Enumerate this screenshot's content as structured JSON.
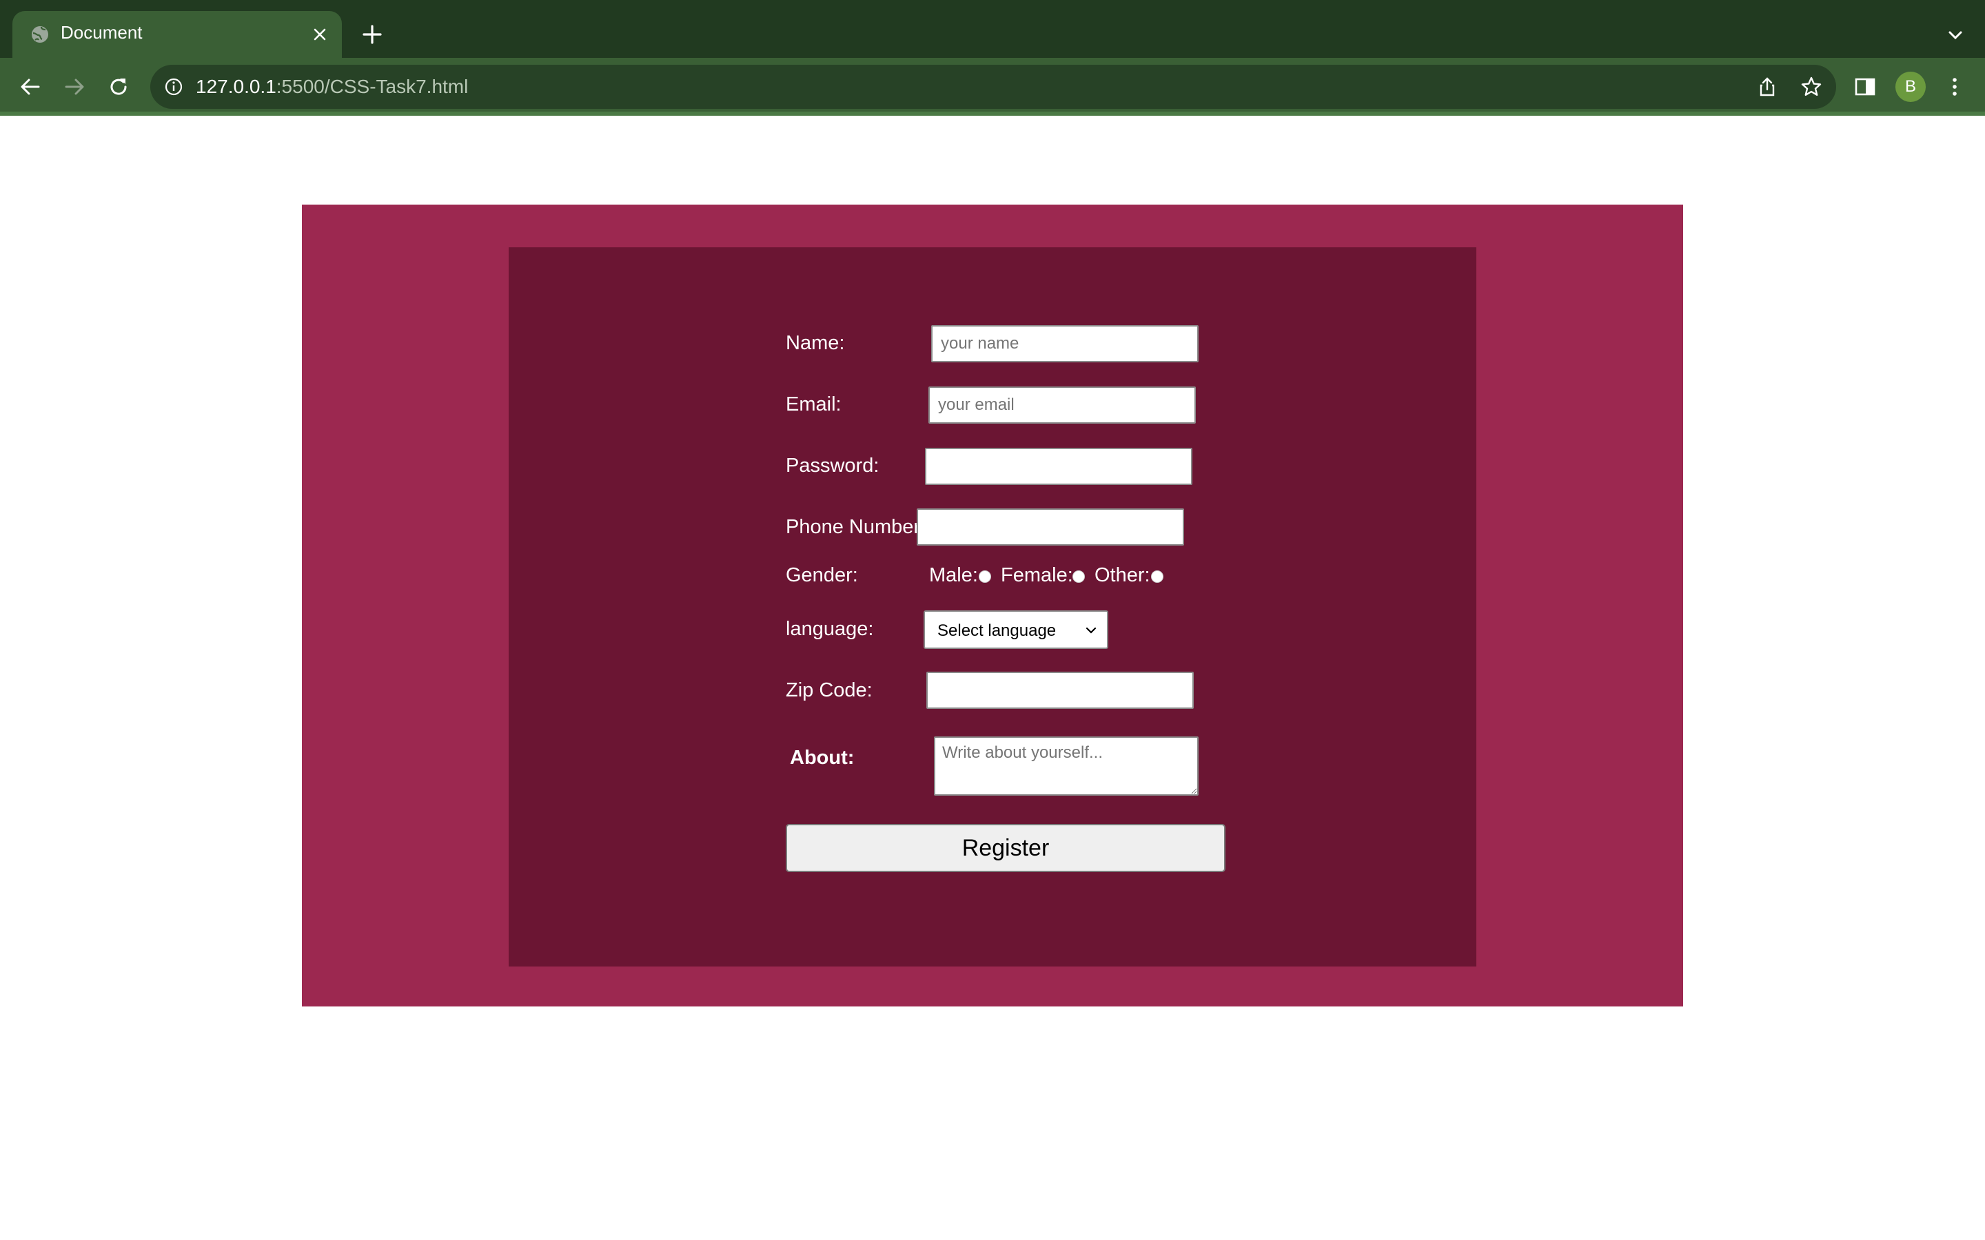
{
  "browser": {
    "tab_title": "Document",
    "url_host": "127.0.0.1",
    "url_rest": ":5500/CSS-Task7.html",
    "profile_initial": "B",
    "colors": {
      "tabbar": "#213a20",
      "toolbar": "#3a5f35",
      "avatar": "#6b9a3e"
    }
  },
  "page": {
    "colors": {
      "outer": "#9c2850",
      "inner": "#6b1533"
    },
    "form": {
      "name_label": "Name:",
      "name_placeholder": "your name",
      "email_label": "Email:",
      "email_placeholder": "your email",
      "password_label": "Password:",
      "phone_label": "Phone Number:",
      "gender_label": "Gender:",
      "gender_options": [
        "Male:",
        "Female:",
        "Other:"
      ],
      "language_label": "language:",
      "language_selected": "Select language",
      "zip_label": "Zip Code:",
      "about_label": "About:",
      "about_placeholder": "Write about yourself...",
      "register_label": "Register"
    }
  }
}
